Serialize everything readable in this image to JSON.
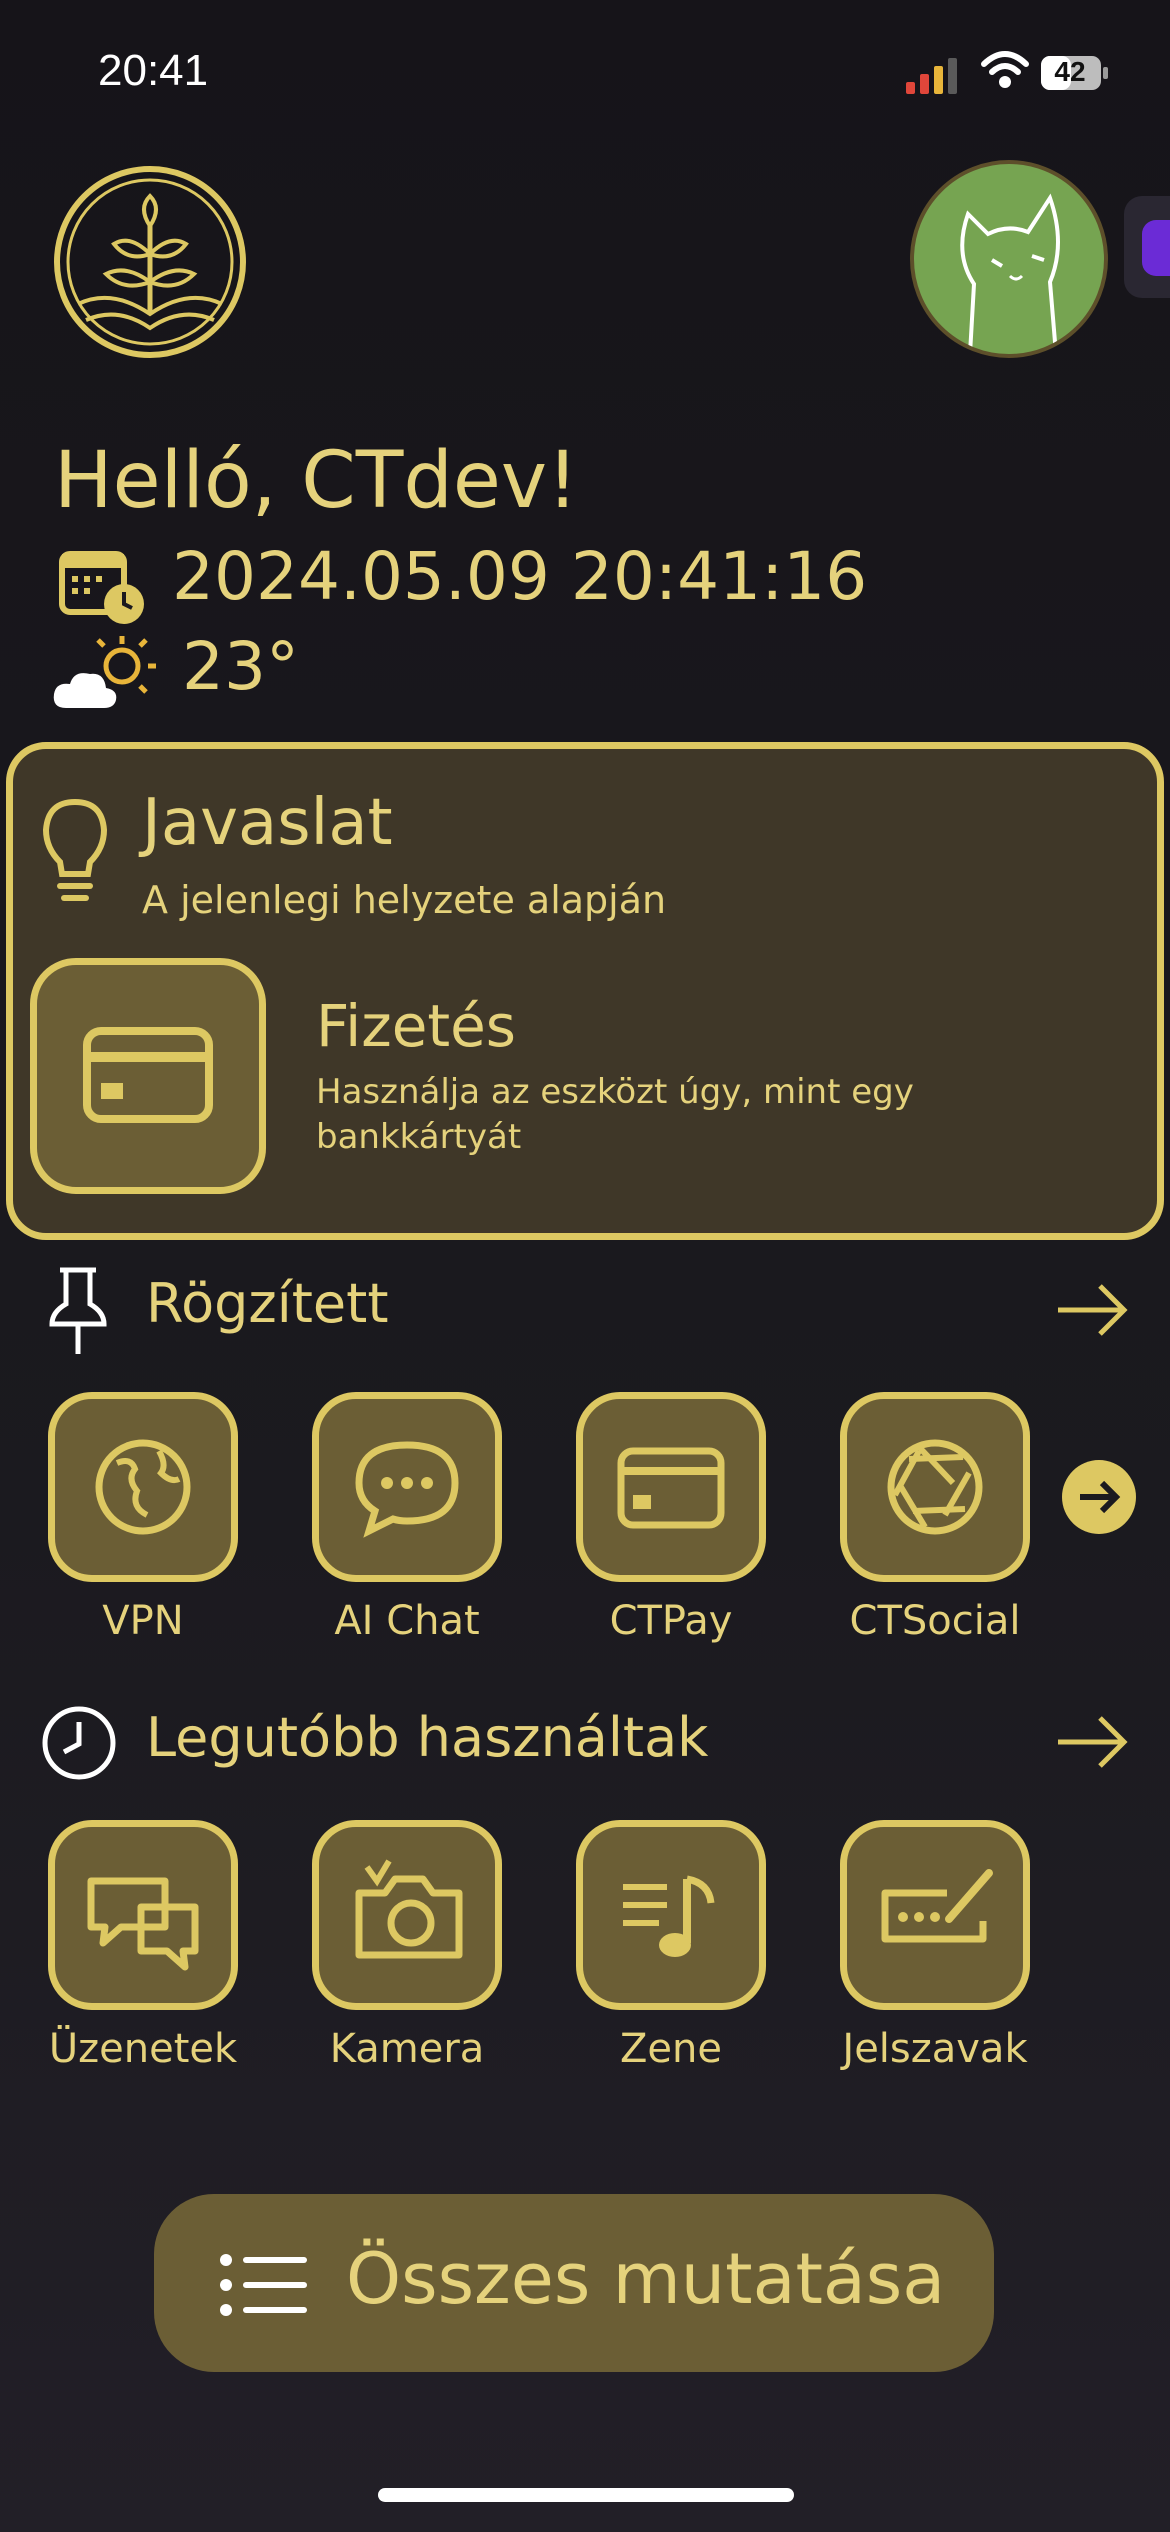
{
  "status_bar": {
    "time": "20:41",
    "battery": "42"
  },
  "header": {
    "greeting": "Helló, CTdev!",
    "datetime": "2024.05.09 20:41:16",
    "temperature": "23°"
  },
  "suggestion": {
    "title": "Javaslat",
    "subtitle": "A jelenlegi helyzete alapján",
    "item_title": "Fizetés",
    "item_desc": "Használja az eszközt úgy, mint egy bankkártyát"
  },
  "pinned": {
    "title": "Rögzített",
    "apps": [
      {
        "label": "VPN",
        "icon": "globe-icon"
      },
      {
        "label": "AI Chat",
        "icon": "chat-bubble-icon"
      },
      {
        "label": "CTPay",
        "icon": "credit-card-icon"
      },
      {
        "label": "CTSocial",
        "icon": "camera-aperture-icon"
      }
    ]
  },
  "recent": {
    "title": "Legutóbb használtak",
    "apps": [
      {
        "label": "Üzenetek",
        "icon": "messages-icon"
      },
      {
        "label": "Kamera",
        "icon": "camera-icon"
      },
      {
        "label": "Zene",
        "icon": "music-note-icon"
      },
      {
        "label": "Jelszavak",
        "icon": "password-pen-icon"
      }
    ]
  },
  "show_all_label": "Összes mutatása",
  "colors": {
    "accent": "#ddc862",
    "text": "#e5d27c",
    "tile": "#6b5e35",
    "card": "#3f3728",
    "background": "#161419"
  }
}
